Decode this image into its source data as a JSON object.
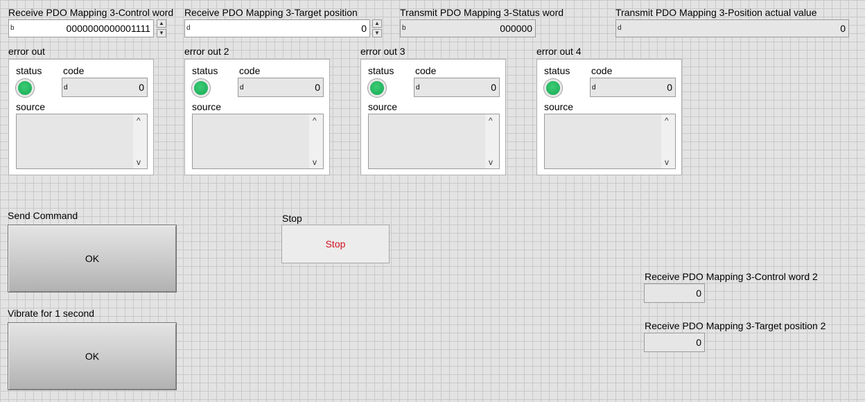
{
  "controls": {
    "rpdo_control_word": {
      "label": "Receive PDO Mapping 3-Control word",
      "radix": "b",
      "value": "0000000000001111"
    },
    "rpdo_target_position": {
      "label": "Receive PDO Mapping 3-Target position",
      "radix": "d",
      "value": "0"
    },
    "tpdo_status_word": {
      "label": "Transmit PDO Mapping 3-Status word",
      "radix": "b",
      "value": "000000"
    },
    "tpdo_position_actual": {
      "label": "Transmit PDO Mapping 3-Position actual value",
      "radix": "d",
      "value": "0"
    }
  },
  "spinner": {
    "up": "▲",
    "down": "▼"
  },
  "error_clusters": [
    {
      "title": "error out",
      "status_label": "status",
      "code_label": "code",
      "code_radix": "d",
      "code_value": "0",
      "source_label": "source",
      "source_value": "",
      "status_color": "#22b35e"
    },
    {
      "title": "error out 2",
      "status_label": "status",
      "code_label": "code",
      "code_radix": "d",
      "code_value": "0",
      "source_label": "source",
      "source_value": "",
      "status_color": "#22b35e"
    },
    {
      "title": "error out 3",
      "status_label": "status",
      "code_label": "code",
      "code_radix": "d",
      "code_value": "0",
      "source_label": "source",
      "source_value": "",
      "status_color": "#22b35e"
    },
    {
      "title": "error out 4",
      "status_label": "status",
      "code_label": "code",
      "code_radix": "d",
      "code_value": "0",
      "source_label": "source",
      "source_value": "",
      "status_color": "#22b35e"
    }
  ],
  "scroll": {
    "up": "^",
    "down": "v"
  },
  "send_command": {
    "label": "Send Command",
    "button": "OK"
  },
  "vibrate": {
    "label": "Vibrate for 1 second",
    "button": "OK"
  },
  "stop": {
    "label": "Stop",
    "button": "Stop",
    "color": "#d0141d"
  },
  "rpdo_control_word_2": {
    "label": "Receive PDO Mapping 3-Control word 2",
    "value": "0"
  },
  "rpdo_target_position_2": {
    "label": "Receive PDO Mapping 3-Target position 2",
    "value": "0"
  }
}
